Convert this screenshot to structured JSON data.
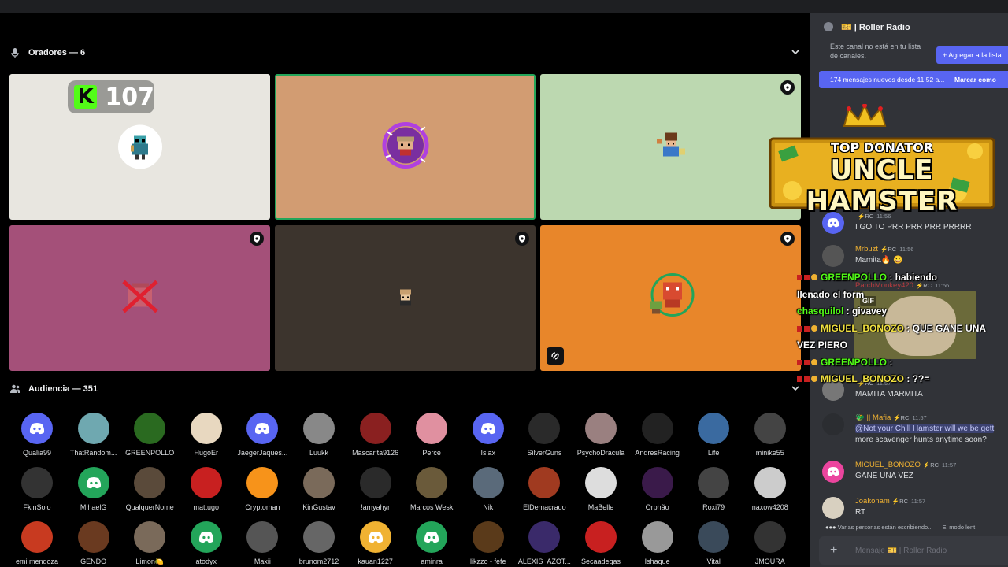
{
  "stage": {
    "speakers_header": "Oradores — 6",
    "audience_header": "Audiencia — 351",
    "kick_count": "107",
    "tiles": [
      {
        "color": "#e8e6e0",
        "name": "tile-1"
      },
      {
        "color": "#d29c72",
        "name": "tile-2"
      },
      {
        "color": "#bcd8b0",
        "name": "tile-3"
      },
      {
        "color": "#a45079",
        "name": "tile-4"
      },
      {
        "color": "#3c342d",
        "name": "tile-5"
      },
      {
        "color": "#e8862a",
        "name": "tile-6"
      }
    ],
    "audience": [
      [
        "Qualia99",
        "ThatRandom...",
        "GREENPOLLO",
        "HugoEr",
        "JaegerJaques...",
        "Luukk",
        "Mascarita9126",
        "Perce",
        "Isiax",
        "SilverGuns",
        "PsychoDracula",
        "AndresRacing",
        "Life",
        "minike55"
      ],
      [
        "FkinSolo",
        "MihaelG",
        "QualquerNome",
        "mattugo",
        "Cryptoman",
        "KinGustav",
        "!amyahyr",
        "Marcos Wesk",
        "Nik",
        "ElDemacrado",
        "MaBelle",
        "Orphão",
        "Roxi79",
        "naxow4208"
      ],
      [
        "emi mendoza",
        "GENDO",
        "Limon🍋",
        "atodyx",
        "Maxii",
        "brunom2712",
        "kauan1227",
        "_aminra_",
        "likzzo - fefe",
        "ALEXIS_AZOT...",
        "Secaadegas",
        "Ishaque",
        "Vital",
        "JMOURA"
      ]
    ]
  },
  "sidebar": {
    "channel_title": "🎫 | Roller Radio",
    "notice": "Este canal no está en tu lista de canales.",
    "add_button": "+ Agregar a la lista",
    "new_messages": "174 mensajes nuevos desde 11:52 a...",
    "mark_read": "Marcar como",
    "messages": [
      {
        "author": "",
        "tag": "⚡RC",
        "time": "11:56",
        "text": "I GO TO PRR PRR PRR PRRRR",
        "color": "#5865f2"
      },
      {
        "author": "Mrbuzt",
        "tag": "⚡RC",
        "time": "11:56",
        "text": "Mamita🔥 😀",
        "color": "#f0b232"
      },
      {
        "author": "ParchMonkey420",
        "tag": "⚡RC",
        "time": "11:56",
        "text": "",
        "color": "#f23f43"
      },
      {
        "author": "",
        "tag": "⚡RC",
        "time": "11:57",
        "text": "MAMITA MARMITA",
        "color": "#dbdee1"
      },
      {
        "author": "🐲 || Mafia",
        "tag": "⚡RC",
        "time": "11:57",
        "text": "@Not your Chill Hamster will we be gett",
        "text2": "more scavenger hunts anytime soon?",
        "color": "#f0b232"
      },
      {
        "author": "MIGUEL_BONOZO",
        "tag": "⚡RC",
        "time": "11:57",
        "text": "GANE UNA VEZ",
        "color": "#f0b232"
      },
      {
        "author": "Joakonam",
        "tag": "⚡RC",
        "time": "11:57",
        "text": "RT",
        "color": "#f0b232"
      }
    ],
    "typing": "Varias personas están escribiendo...",
    "slow_mode": "El modo lent",
    "composer_placeholder": "Mensaje 🎫 | Roller Radio",
    "gif_label": "GIF"
  },
  "overlay": {
    "banner_top": "TOP DONATOR",
    "banner_name": "UNCLE HAMSTER",
    "lines": [
      {
        "user": "GREENPOLLO",
        "user_color": "#53fc18",
        "text": " : habiendo"
      },
      {
        "user": "",
        "user_color": "#fff",
        "text": "llenado el form"
      },
      {
        "user": "chasquilol",
        "user_color": "#53fc18",
        "text": " : givavey"
      },
      {
        "user": "MIGUEL_BONOZO",
        "user_color": "#f0e040",
        "text": " : QUE GANE UNA"
      },
      {
        "user": "",
        "user_color": "#fff",
        "text": "VEZ PIERO"
      },
      {
        "user": "GREENPOLLO",
        "user_color": "#53fc18",
        "text": " :"
      },
      {
        "user": "MIGUEL_BONOZO",
        "user_color": "#f0e040",
        "text": " : ??="
      }
    ]
  },
  "colors": {
    "discord_blurple": "#5865f2",
    "discord_green": "#23a55a",
    "stage_bg": "#000000",
    "sidebar_bg": "#313338"
  }
}
